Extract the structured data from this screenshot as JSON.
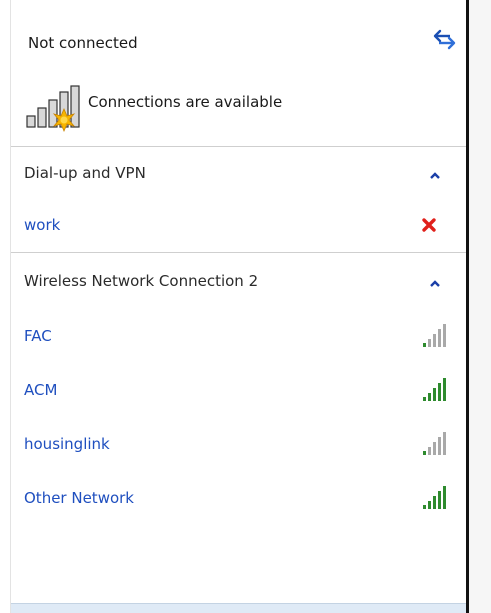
{
  "status": {
    "title": "Not connected",
    "subtitle": "Connections are available",
    "refresh_icon": "refresh-arrows-icon"
  },
  "colors": {
    "link": "#1f4fbf",
    "signal_strong": "#2e8b2e",
    "signal_weak": "#a9a9a9",
    "disconnect_red": "#e0201b",
    "chevron": "#1b3fa8"
  },
  "sections": [
    {
      "title": "Dial-up and VPN",
      "expanded": true,
      "items": [
        {
          "name": "work",
          "icon": "disconnect-x-icon"
        }
      ]
    },
    {
      "title": "Wireless Network Connection 2",
      "expanded": true,
      "items": [
        {
          "name": "FAC",
          "icon": "signal-icon",
          "signal": "weak"
        },
        {
          "name": "ACM",
          "icon": "signal-icon",
          "signal": "strong"
        },
        {
          "name": "housinglink",
          "icon": "signal-icon",
          "signal": "weak"
        },
        {
          "name": "Other Network",
          "icon": "signal-icon",
          "signal": "strong"
        }
      ]
    }
  ]
}
